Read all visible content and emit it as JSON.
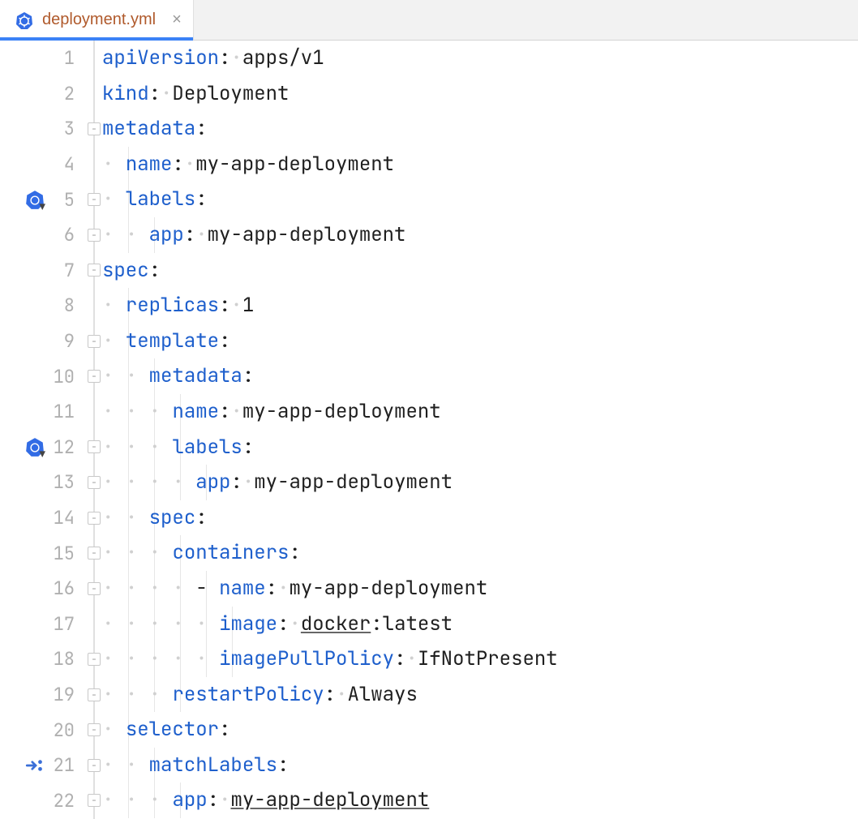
{
  "tab": {
    "filename": "deployment.yml",
    "icon": "kubernetes-icon"
  },
  "gutterIcons": {
    "5": "kubernetes-run-icon",
    "12": "kubernetes-run-icon",
    "21": "arrow-breakpoint-icon"
  },
  "foldToggles": [
    3,
    5,
    6,
    7,
    9,
    10,
    12,
    13,
    14,
    15,
    16,
    18,
    19,
    20,
    21,
    22
  ],
  "lines": [
    {
      "n": 1,
      "indent": 0,
      "tokens": [
        [
          "key",
          "apiVersion"
        ],
        [
          "punct",
          ": "
        ],
        [
          "val",
          "apps/v1"
        ]
      ]
    },
    {
      "n": 2,
      "indent": 0,
      "tokens": [
        [
          "key",
          "kind"
        ],
        [
          "punct",
          ": "
        ],
        [
          "val",
          "Deployment"
        ]
      ]
    },
    {
      "n": 3,
      "indent": 0,
      "tokens": [
        [
          "key",
          "metadata"
        ],
        [
          "punct",
          ":"
        ]
      ]
    },
    {
      "n": 4,
      "indent": 1,
      "tokens": [
        [
          "key",
          "name"
        ],
        [
          "punct",
          ": "
        ],
        [
          "val",
          "my-app-deployment"
        ]
      ]
    },
    {
      "n": 5,
      "indent": 1,
      "tokens": [
        [
          "key",
          "labels"
        ],
        [
          "punct",
          ":"
        ]
      ]
    },
    {
      "n": 6,
      "indent": 2,
      "tokens": [
        [
          "key",
          "app"
        ],
        [
          "punct",
          ": "
        ],
        [
          "val",
          "my-app-deployment"
        ]
      ]
    },
    {
      "n": 7,
      "indent": 0,
      "tokens": [
        [
          "key",
          "spec"
        ],
        [
          "punct",
          ":"
        ]
      ]
    },
    {
      "n": 8,
      "indent": 1,
      "tokens": [
        [
          "key",
          "replicas"
        ],
        [
          "punct",
          ": "
        ],
        [
          "val",
          "1"
        ]
      ]
    },
    {
      "n": 9,
      "indent": 1,
      "tokens": [
        [
          "key",
          "template"
        ],
        [
          "punct",
          ":"
        ]
      ]
    },
    {
      "n": 10,
      "indent": 2,
      "tokens": [
        [
          "key",
          "metadata"
        ],
        [
          "punct",
          ":"
        ]
      ]
    },
    {
      "n": 11,
      "indent": 3,
      "tokens": [
        [
          "key",
          "name"
        ],
        [
          "punct",
          ": "
        ],
        [
          "val",
          "my-app-deployment"
        ]
      ]
    },
    {
      "n": 12,
      "indent": 3,
      "tokens": [
        [
          "key",
          "labels"
        ],
        [
          "punct",
          ":"
        ]
      ]
    },
    {
      "n": 13,
      "indent": 4,
      "tokens": [
        [
          "key",
          "app"
        ],
        [
          "punct",
          ": "
        ],
        [
          "val",
          "my-app-deployment"
        ]
      ]
    },
    {
      "n": 14,
      "indent": 2,
      "tokens": [
        [
          "key",
          "spec"
        ],
        [
          "punct",
          ":"
        ]
      ]
    },
    {
      "n": 15,
      "indent": 3,
      "tokens": [
        [
          "key",
          "containers"
        ],
        [
          "punct",
          ":"
        ]
      ]
    },
    {
      "n": 16,
      "indent": 4,
      "dash": true,
      "tokens": [
        [
          "key",
          "name"
        ],
        [
          "punct",
          ": "
        ],
        [
          "val",
          "my-app-deployment"
        ]
      ]
    },
    {
      "n": 17,
      "indent": 5,
      "tokens": [
        [
          "key",
          "image"
        ],
        [
          "punct",
          ": "
        ],
        [
          "val-under",
          "docker"
        ],
        [
          "val",
          ":latest"
        ]
      ]
    },
    {
      "n": 18,
      "indent": 5,
      "tokens": [
        [
          "key",
          "imagePullPolicy"
        ],
        [
          "punct",
          ": "
        ],
        [
          "val",
          "IfNotPresent"
        ]
      ]
    },
    {
      "n": 19,
      "indent": 3,
      "tokens": [
        [
          "key",
          "restartPolicy"
        ],
        [
          "punct",
          ": "
        ],
        [
          "val",
          "Always"
        ]
      ]
    },
    {
      "n": 20,
      "indent": 1,
      "tokens": [
        [
          "key",
          "selector"
        ],
        [
          "punct",
          ":"
        ]
      ]
    },
    {
      "n": 21,
      "indent": 2,
      "tokens": [
        [
          "key",
          "matchLabels"
        ],
        [
          "punct",
          ":"
        ]
      ]
    },
    {
      "n": 22,
      "indent": 3,
      "tokens": [
        [
          "key",
          "app"
        ],
        [
          "punct",
          ": "
        ],
        [
          "val-under",
          "my-app-deployment"
        ]
      ]
    }
  ]
}
